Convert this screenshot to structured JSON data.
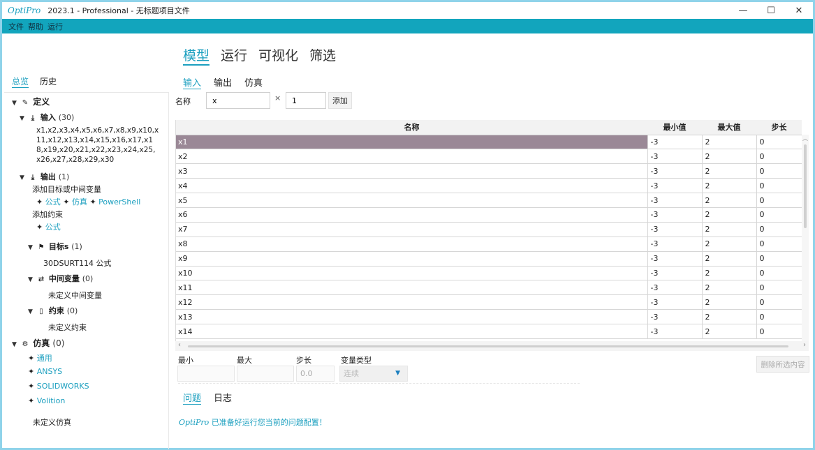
{
  "window": {
    "logo": "OptiPro",
    "title": "2023.1 - Professional - 无标题项目文件",
    "minimize": "—",
    "maximize": "☐",
    "close": "✕"
  },
  "menu": [
    "文件",
    "帮助",
    "运行"
  ],
  "sidebar": {
    "tabs": [
      "总览",
      "历史"
    ],
    "definition": {
      "label": "定义"
    },
    "inputs": {
      "label": "输入",
      "count": "(30)",
      "vars": "x1,x2,x3,x4,x5,x6,x7,x8,x9,x10,x11,x12,x13,x14,x15,x16,x17,x18,x19,x20,x21,x22,x23,x24,x25,x26,x27,x28,x29,x30"
    },
    "outputs": {
      "label": "输出",
      "count": "(1)",
      "add_goal": "添加目标或中间变量",
      "links": [
        "公式",
        "仿真",
        "PowerShell"
      ],
      "add_constraint": "添加约束",
      "constraint_link": "公式"
    },
    "targets": {
      "label": "目标s",
      "count": "(1)",
      "item": "30DSURT114  公式"
    },
    "intermediate": {
      "label": "中间变量",
      "count": "(0)",
      "empty": "未定义中间变量"
    },
    "constraints": {
      "label": "约束",
      "count": "(0)",
      "empty": "未定义约束"
    },
    "simulation": {
      "label": "仿真",
      "count": "(0)",
      "items": [
        "通用",
        "ANSYS",
        "SOLIDWORKS",
        "Volition"
      ],
      "empty": "未定义仿真"
    }
  },
  "main": {
    "tabs": [
      "模型",
      "运行",
      "可视化",
      "筛选"
    ],
    "subtabs": [
      "输入",
      "输出",
      "仿真"
    ],
    "form": {
      "name_label": "名称",
      "name_value": "x",
      "times": "×",
      "count_value": "1",
      "add_button": "添加"
    },
    "table": {
      "headers": [
        "名称",
        "最小值",
        "最大值",
        "步长"
      ],
      "rows": [
        [
          "x1",
          "-3",
          "2",
          "0"
        ],
        [
          "x2",
          "-3",
          "2",
          "0"
        ],
        [
          "x3",
          "-3",
          "2",
          "0"
        ],
        [
          "x4",
          "-3",
          "2",
          "0"
        ],
        [
          "x5",
          "-3",
          "2",
          "0"
        ],
        [
          "x6",
          "-3",
          "2",
          "0"
        ],
        [
          "x7",
          "-3",
          "2",
          "0"
        ],
        [
          "x8",
          "-3",
          "2",
          "0"
        ],
        [
          "x9",
          "-3",
          "2",
          "0"
        ],
        [
          "x10",
          "-3",
          "2",
          "0"
        ],
        [
          "x11",
          "-3",
          "2",
          "0"
        ],
        [
          "x12",
          "-3",
          "2",
          "0"
        ],
        [
          "x13",
          "-3",
          "2",
          "0"
        ],
        [
          "x14",
          "-3",
          "2",
          "0"
        ]
      ]
    },
    "editor": {
      "min_label": "最小",
      "max_label": "最大",
      "step_label": "步长",
      "type_label": "变量类型",
      "step_value": "0.0",
      "type_value": "连续",
      "delete_button": "删除所选内容"
    },
    "bottom_tabs": [
      "问题",
      "日志"
    ],
    "status": {
      "logo": "OptiPro",
      "message": "已准备好运行您当前的问题配置！"
    }
  }
}
